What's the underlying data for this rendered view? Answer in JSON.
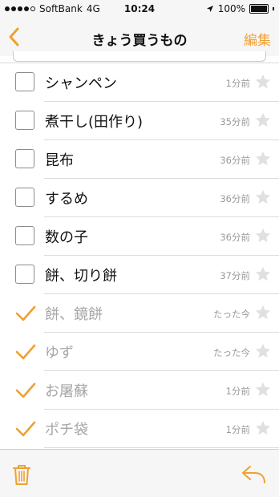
{
  "status_bar": {
    "carrier": "SoftBank",
    "network": "4G",
    "time": "10:24",
    "battery": "100%"
  },
  "nav": {
    "title": "きょう買うもの",
    "edit_label": "編集"
  },
  "colors": {
    "accent": "#f0a030",
    "done_text": "#a6a6a6",
    "star": "#e0e0e0"
  },
  "items": [
    {
      "label": "シャンペン",
      "time": "1分前",
      "checked": false
    },
    {
      "label": "煮干し(田作り)",
      "time": "35分前",
      "checked": false
    },
    {
      "label": "昆布",
      "time": "36分前",
      "checked": false
    },
    {
      "label": "するめ",
      "time": "36分前",
      "checked": false
    },
    {
      "label": "数の子",
      "time": "36分前",
      "checked": false
    },
    {
      "label": "餅、切り餅",
      "time": "37分前",
      "checked": false
    },
    {
      "label": "餅、鏡餅",
      "time": "たった今",
      "checked": true
    },
    {
      "label": "ゆず",
      "time": "たった今",
      "checked": true
    },
    {
      "label": "お屠蘇",
      "time": "1分前",
      "checked": true
    },
    {
      "label": "ポチ袋",
      "time": "1分前",
      "checked": true
    }
  ],
  "toolbar": {
    "left_icon": "trash-icon",
    "right_icon": "reply-icon"
  }
}
